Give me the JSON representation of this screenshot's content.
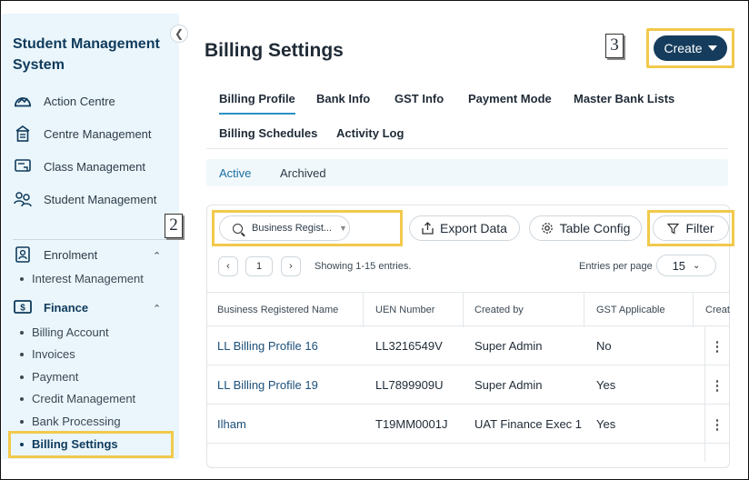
{
  "sidebar": {
    "title": "Student Management System",
    "items": [
      {
        "label": "Action Centre",
        "icon": "action-centre-icon"
      },
      {
        "label": "Centre Management",
        "icon": "building-icon"
      },
      {
        "label": "Class Management",
        "icon": "class-icon"
      },
      {
        "label": "Student Management",
        "icon": "students-icon"
      }
    ],
    "enrolment": {
      "label": "Enrolment",
      "sub": [
        "Interest Management"
      ]
    },
    "finance": {
      "label": "Finance",
      "sub": [
        "Billing Account",
        "Invoices",
        "Payment",
        "Credit Management",
        "Bank Processing",
        "Billing Settings"
      ]
    }
  },
  "header": {
    "title": "Billing Settings",
    "create_label": "Create"
  },
  "markers": {
    "two": "2",
    "three": "3"
  },
  "tabs": [
    "Billing Profile",
    "Bank Info",
    "GST Info",
    "Payment Mode",
    "Master Bank Lists",
    "Billing Schedules",
    "Activity Log"
  ],
  "subtabs": [
    "Active",
    "Archived"
  ],
  "toolbar": {
    "search_value": "Business Regist...",
    "export_label": "Export Data",
    "config_label": "Table Config",
    "filter_label": "Filter"
  },
  "pagination": {
    "page": "1",
    "showing": "Showing 1-15 entries.",
    "entries_label": "Entries per page",
    "entries_value": "15"
  },
  "table": {
    "columns": [
      "Business Registered Name",
      "UEN Number",
      "Created by",
      "GST Applicable",
      "Creat"
    ],
    "rows": [
      {
        "name": "LL Billing Profile 16",
        "uen": "LL3216549V",
        "created_by": "Super Admin",
        "gst": "No"
      },
      {
        "name": "LL Billing Profile 19",
        "uen": "LL7899909U",
        "created_by": "Super Admin",
        "gst": "Yes"
      },
      {
        "name": "Ilham",
        "uen": "T19MM0001J",
        "created_by": "UAT Finance Exec 1",
        "gst": "Yes"
      }
    ]
  },
  "colors": {
    "accent": "#153c5c",
    "highlight": "#f2c94c",
    "sidebar_bg": "#eaf6fb",
    "tab_underline": "#2a8fc4"
  }
}
